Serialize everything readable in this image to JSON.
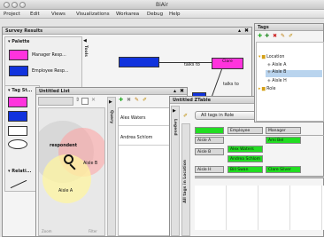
{
  "app": {
    "title": "BiAir"
  },
  "menubar": [
    "Project",
    "Edit",
    "Views",
    "Visualizations",
    "Workarea",
    "Debug",
    "Help"
  ],
  "survey": {
    "title": "Survey Results",
    "palette": {
      "title": "Palette",
      "items": [
        "Manager Resp...",
        "Employee Resp..."
      ],
      "side_label": "Tools"
    },
    "tag_styles": {
      "title": "Tag St..."
    },
    "relations": {
      "title": "Relati..."
    },
    "graph": {
      "edge_label_1": "talks to",
      "edge_label_2": "talks to",
      "node_clare": "Clare"
    }
  },
  "untitled_list": {
    "title": "Untitled List",
    "side_label": "Query",
    "items": [
      "Alex Waters",
      "Andrea Schlom"
    ],
    "venn": {
      "respondents": "respondent",
      "aisle_a": "Aisle A",
      "aisle_b": "Aisle B"
    },
    "footer": [
      "Zoom",
      "Filter"
    ]
  },
  "ztable": {
    "title": "Untitled ZTable",
    "side_label_legend": "Legend",
    "side_label_tags": "All tags in Location",
    "dropdown": "All tags in Role",
    "headers": [
      "Employee",
      "Manager"
    ],
    "rows": [
      {
        "label": "Aisle A",
        "employee": "",
        "manager": "Ami Bel"
      },
      {
        "label": "Aisle B",
        "employee": "Alex Waters",
        "manager": ""
      },
      {
        "label": "",
        "employee": "Andrea Schlom",
        "manager": ""
      },
      {
        "label": "Aisle H",
        "employee": "Bill Swan",
        "manager": "Clare Silver"
      }
    ]
  },
  "tags": {
    "title": "Tags",
    "items": [
      "Location",
      "Aisle A",
      "Aisle B",
      "Aisle H",
      "Role"
    ]
  },
  "colors": {
    "green": "#22dd22",
    "magenta": "#ff33dd",
    "blue": "#1133dd",
    "highlight": "#b9d4ee"
  }
}
